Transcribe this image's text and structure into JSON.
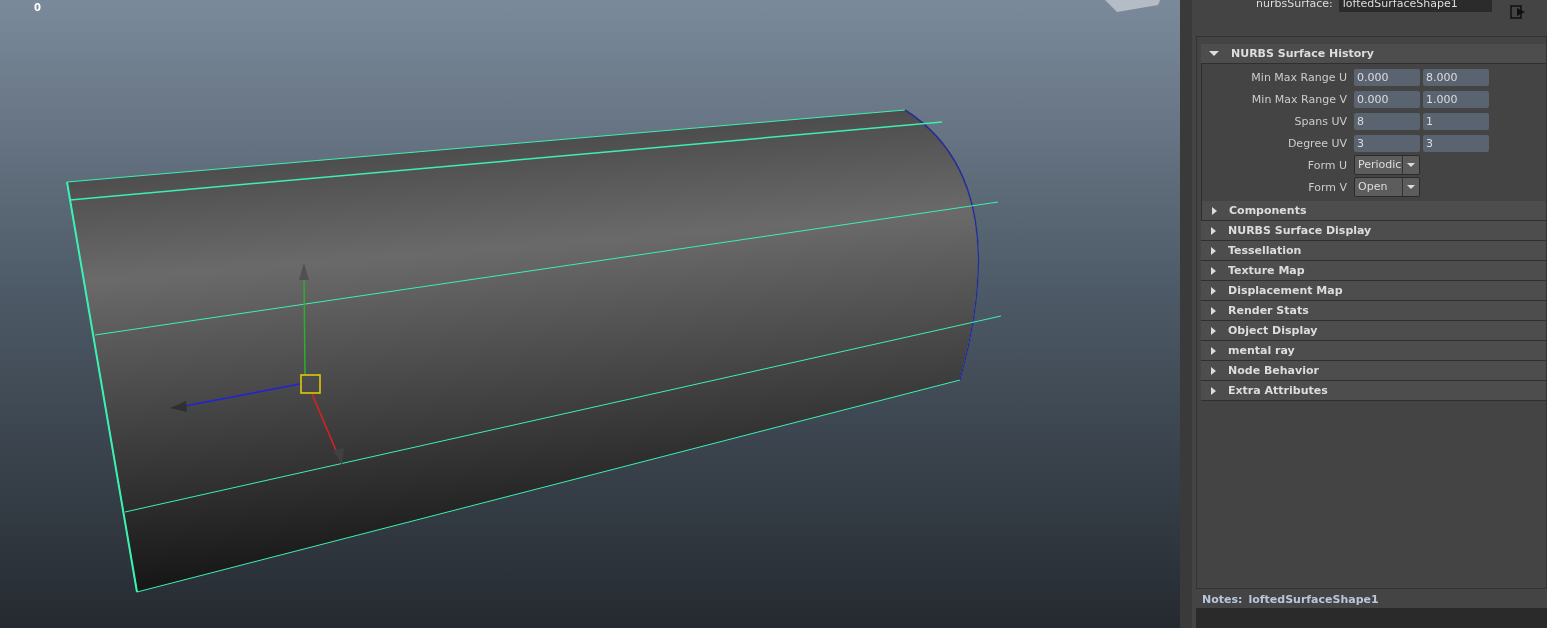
{
  "viewport": {
    "frame_counter": "0"
  },
  "attribute_editor": {
    "node_label": "nurbsSurface:",
    "node_name": "loftedSurfaceShape1",
    "sections": [
      {
        "title": "NURBS Surface History",
        "expanded": true,
        "attributes": [
          {
            "kind": "pair",
            "label": "Min Max Range U",
            "values": [
              "0.000",
              "8.000"
            ]
          },
          {
            "kind": "pair",
            "label": "Min Max Range V",
            "values": [
              "0.000",
              "1.000"
            ]
          },
          {
            "kind": "pair",
            "label": "Spans UV",
            "values": [
              "8",
              "1"
            ]
          },
          {
            "kind": "pair",
            "label": "Degree UV",
            "values": [
              "3",
              "3"
            ]
          },
          {
            "kind": "dropdown",
            "label": "Form U",
            "value": "Periodic"
          },
          {
            "kind": "dropdown",
            "label": "Form V",
            "value": "Open"
          }
        ],
        "children": [
          {
            "title": "Components",
            "expanded": false
          }
        ]
      },
      {
        "title": "NURBS Surface Display",
        "expanded": false
      },
      {
        "title": "Tessellation",
        "expanded": false
      },
      {
        "title": "Texture Map",
        "expanded": false
      },
      {
        "title": "Displacement Map",
        "expanded": false
      },
      {
        "title": "Render Stats",
        "expanded": false
      },
      {
        "title": "Object Display",
        "expanded": false
      },
      {
        "title": "mental ray",
        "expanded": false
      },
      {
        "title": "Node Behavior",
        "expanded": false
      },
      {
        "title": "Extra Attributes",
        "expanded": false
      }
    ],
    "notes_label": "Notes:",
    "notes_node": "loftedSurfaceShape1"
  }
}
